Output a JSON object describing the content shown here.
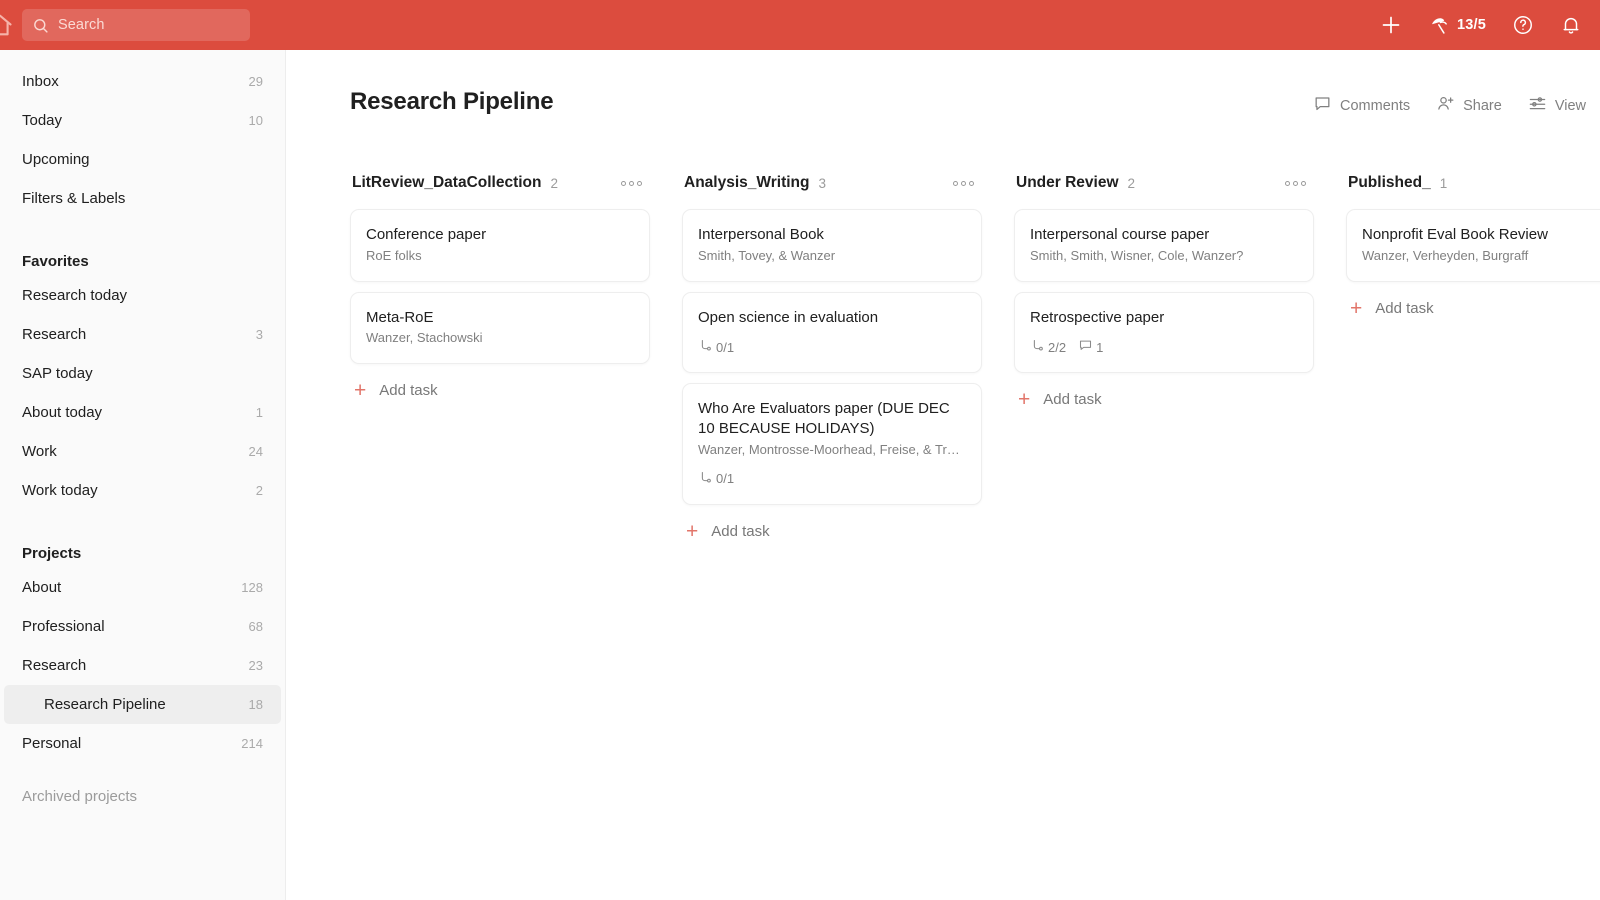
{
  "topbar": {
    "home_icon": "home-icon",
    "search": {
      "placeholder": "Search",
      "value": "",
      "icon": "search-icon"
    },
    "add_icon": "plus-icon",
    "productivity": {
      "icon": "productivity-icon",
      "count": "13/5"
    },
    "help_icon": "help-circle-icon",
    "notifications_icon": "bell-icon"
  },
  "sidebar": {
    "items": [
      {
        "label": "Inbox",
        "count": "29",
        "type": "nav",
        "selected": false
      },
      {
        "label": "Today",
        "count": "10",
        "type": "nav",
        "selected": false
      },
      {
        "label": "Upcoming",
        "count": "",
        "type": "nav",
        "selected": false
      },
      {
        "label": "Filters & Labels",
        "count": "",
        "type": "nav",
        "selected": false
      }
    ],
    "favorites": {
      "heading": "Favorites",
      "items": [
        {
          "label": "Research today",
          "count": "",
          "selected": false
        },
        {
          "label": "Research",
          "count": "3",
          "selected": false
        },
        {
          "label": "SAP today",
          "count": "",
          "selected": false
        },
        {
          "label": "About today",
          "count": "1",
          "selected": false
        },
        {
          "label": "Work",
          "count": "24",
          "selected": false
        },
        {
          "label": "Work today",
          "count": "2",
          "selected": false
        }
      ]
    },
    "projects": {
      "heading": "Projects",
      "items": [
        {
          "label": "About",
          "count": "128",
          "selected": false,
          "nested": false
        },
        {
          "label": "Professional",
          "count": "68",
          "selected": false,
          "nested": false
        },
        {
          "label": "Research",
          "count": "23",
          "selected": false,
          "nested": false
        },
        {
          "label": "Research Pipeline",
          "count": "18",
          "selected": true,
          "nested": true
        },
        {
          "label": "Personal",
          "count": "214",
          "selected": false,
          "nested": false
        }
      ]
    },
    "archived_label": "Archived projects"
  },
  "main": {
    "title": "Research Pipeline",
    "actions": [
      {
        "label": "Comments",
        "icon": "comment-icon"
      },
      {
        "label": "Share",
        "icon": "person-add-icon"
      },
      {
        "label": "View",
        "icon": "sliders-icon"
      }
    ],
    "add_task_label": "Add task",
    "columns": [
      {
        "title": "LitReview_DataCollection",
        "count": "2",
        "cards": [
          {
            "title": "Conference paper",
            "subtitle": "RoE folks",
            "subtasks": "",
            "comments": ""
          },
          {
            "title": "Meta-RoE",
            "subtitle": "Wanzer, Stachowski",
            "subtasks": "",
            "comments": ""
          }
        ]
      },
      {
        "title": "Analysis_Writing",
        "count": "3",
        "cards": [
          {
            "title": "Interpersonal Book",
            "subtitle": "Smith, Tovey, & Wanzer",
            "subtasks": "",
            "comments": ""
          },
          {
            "title": "Open science in evaluation",
            "subtitle": "",
            "subtasks": "0/1",
            "comments": ""
          },
          {
            "title": "Who Are Evaluators paper (DUE DEC 10 BECAUSE HOLIDAYS)",
            "subtitle": "Wanzer, Montrosse-Moorhead, Freise, & Tr…",
            "subtasks": "0/1",
            "comments": ""
          }
        ]
      },
      {
        "title": "Under Review",
        "count": "2",
        "cards": [
          {
            "title": "Interpersonal course paper",
            "subtitle": "Smith, Smith, Wisner, Cole, Wanzer?",
            "subtasks": "",
            "comments": ""
          },
          {
            "title": "Retrospective paper",
            "subtitle": "",
            "subtasks": "2/2",
            "comments": "1"
          }
        ]
      },
      {
        "title": "Published_",
        "count": "1",
        "cards": [
          {
            "title": "Nonprofit Eval Book Review",
            "subtitle": "Wanzer, Verheyden, Burgraff",
            "subtasks": "",
            "comments": ""
          }
        ]
      }
    ]
  },
  "colors": {
    "brand": "#dc4c3e",
    "accent": "#e2756a",
    "selected_row": "#eeeeee"
  }
}
